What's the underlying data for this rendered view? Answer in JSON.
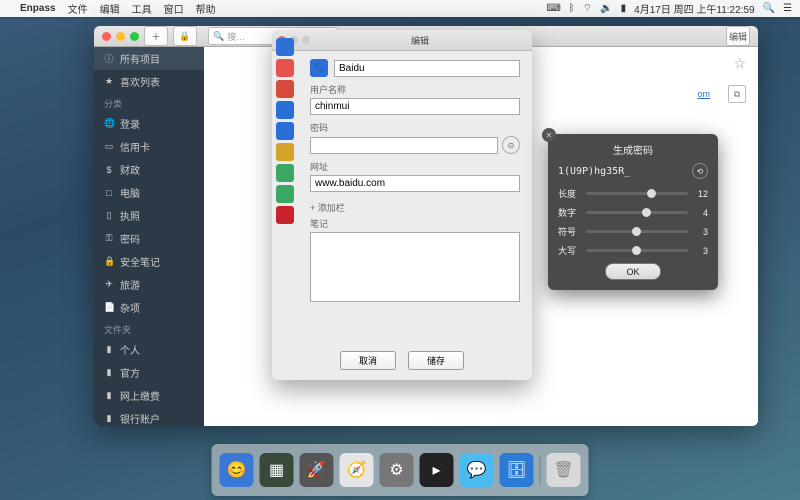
{
  "menubar": {
    "app": "Enpass",
    "menus": [
      "文件",
      "编辑",
      "工具",
      "窗口",
      "帮助"
    ],
    "datetime": "4月17日 周四 上午11:22:59"
  },
  "toolbar": {
    "search_placeholder": "搜…",
    "edit_label": "编辑"
  },
  "sidebar": {
    "all": {
      "label": "所有项目"
    },
    "fav": {
      "label": "喜欢列表"
    },
    "cat_header": "分类",
    "cats": [
      {
        "icon": "globe",
        "label": "登录"
      },
      {
        "icon": "card",
        "label": "信用卡"
      },
      {
        "icon": "money",
        "label": "财政"
      },
      {
        "icon": "pc",
        "label": "电脑"
      },
      {
        "icon": "id",
        "label": "执照"
      },
      {
        "icon": "key",
        "label": "密码"
      },
      {
        "icon": "lock",
        "label": "安全笔记"
      },
      {
        "icon": "plane",
        "label": "旅游"
      },
      {
        "icon": "note",
        "label": "杂项"
      }
    ],
    "fold_header": "文件夹",
    "folders": [
      "个人",
      "官方",
      "网上缴费",
      "银行账户"
    ]
  },
  "edit": {
    "title": "编辑",
    "item_title": "Baidu",
    "username_lbl": "用户名称",
    "username": "chinmui",
    "password_lbl": "密码",
    "password": "",
    "url_lbl": "网址",
    "url": "www.baidu.com",
    "add_field": "+ 添加栏",
    "notes_lbl": "笔记",
    "cancel": "取消",
    "save": "储存"
  },
  "gen": {
    "title": "生成密码",
    "password": "1(U9P)hg35R_",
    "rows": [
      {
        "label": "长度",
        "value": 12,
        "pos": 60
      },
      {
        "label": "数字",
        "value": 4,
        "pos": 55
      },
      {
        "label": "符号",
        "value": 3,
        "pos": 45
      },
      {
        "label": "大写",
        "value": 3,
        "pos": 45
      }
    ],
    "ok": "OK"
  },
  "detail_link": "om"
}
